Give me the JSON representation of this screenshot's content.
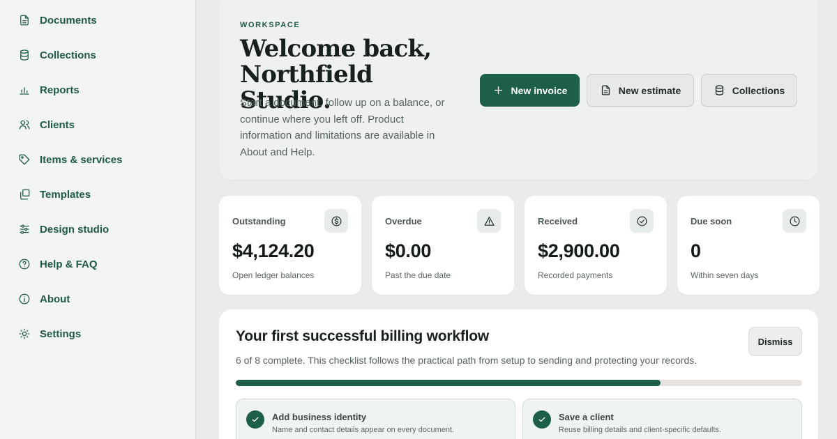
{
  "sidebar": {
    "items": [
      {
        "label": "Documents",
        "icon": "document-icon"
      },
      {
        "label": "Collections",
        "icon": "database-icon"
      },
      {
        "label": "Reports",
        "icon": "bar-chart-icon"
      },
      {
        "label": "Clients",
        "icon": "users-icon"
      },
      {
        "label": "Items & services",
        "icon": "tag-icon"
      },
      {
        "label": "Templates",
        "icon": "copy-icon"
      },
      {
        "label": "Design studio",
        "icon": "sliders-icon"
      },
      {
        "label": "Help & FAQ",
        "icon": "help-circle-icon"
      },
      {
        "label": "About",
        "icon": "info-icon"
      },
      {
        "label": "Settings",
        "icon": "sun-icon"
      }
    ]
  },
  "hero": {
    "eyebrow": "WORKSPACE",
    "title_line1": "Welcome back,",
    "title_line2": "Northfield Studio.",
    "description": "Start a document, follow up on a balance, or continue where you left off. Product information and limitations are available in About and Help.",
    "actions": {
      "new_invoice": "New invoice",
      "new_estimate": "New estimate",
      "collections": "Collections"
    }
  },
  "stats": [
    {
      "label": "Outstanding",
      "value": "$4,124.20",
      "sub": "Open ledger balances",
      "icon": "dollar-circle-icon"
    },
    {
      "label": "Overdue",
      "value": "$0.00",
      "sub": "Past the due date",
      "icon": "warning-icon"
    },
    {
      "label": "Received",
      "value": "$2,900.00",
      "sub": "Recorded payments",
      "icon": "check-circle-icon"
    },
    {
      "label": "Due soon",
      "value": "0",
      "sub": "Within seven days",
      "icon": "clock-icon"
    }
  ],
  "checklist": {
    "title": "Your first successful billing workflow",
    "description": "6 of 8 complete. This checklist follows the practical path from setup to sending and protecting your records.",
    "dismiss_label": "Dismiss",
    "progress_fraction": 0.75,
    "tasks": [
      {
        "title": "Add business identity",
        "sub": "Name and contact details appear on every document.",
        "done": true
      },
      {
        "title": "Save a client",
        "sub": "Reuse billing details and client-specific defaults.",
        "done": true
      }
    ]
  },
  "colors": {
    "accent": "#1d5f48",
    "sidebar_bg": "#f3f5f4",
    "page_bg": "#e9ecea"
  }
}
